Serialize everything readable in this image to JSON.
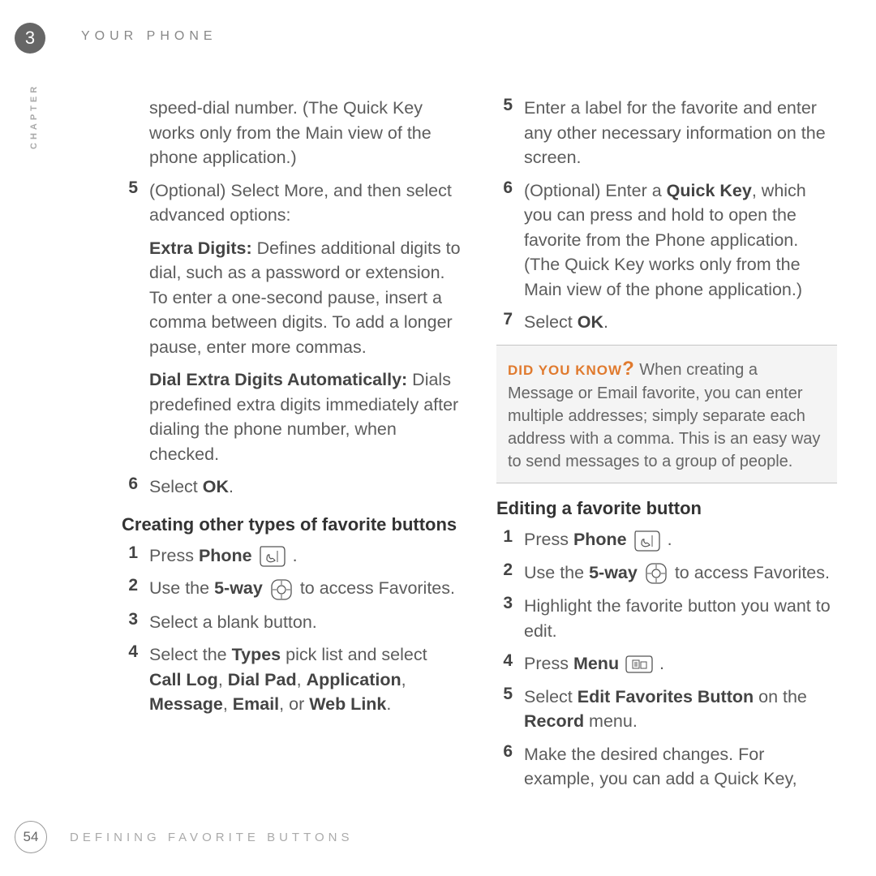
{
  "header": {
    "chapter_number": "3",
    "section_title": "YOUR PHONE",
    "chapter_label": "CHAPTER"
  },
  "left_col": {
    "intro": "speed-dial number. (The Quick Key works only from the Main view of the phone application.)",
    "step5_num": "5",
    "step5_text": "(Optional) Select More, and then select advanced options:",
    "extra_label": "Extra Digits:",
    "extra_text": " Defines additional digits to dial, such as a password or extension. To enter a one-second pause, insert a comma between digits. To add a longer pause, enter more commas.",
    "dial_label": "Dial Extra Digits Automatically:",
    "dial_text": " Dials predefined extra digits immediately after dialing the phone number, when checked.",
    "step6_num": "6",
    "step6_prefix": "Select ",
    "step6_bold": "OK",
    "step6_suffix": ".",
    "subhead": "Creating other types of favorite buttons",
    "c1_num": "1",
    "c1_prefix": "Press ",
    "c1_bold": "Phone",
    "c1_suffix": " .",
    "c2_num": "2",
    "c2_prefix": "Use the ",
    "c2_bold": "5-way",
    "c2_suffix": " to access Favorites.",
    "c3_num": "3",
    "c3_text": "Select a blank button.",
    "c4_num": "4",
    "c4_a": "Select the ",
    "c4_types": "Types",
    "c4_b": " pick list and select ",
    "c4_calllog": "Call Log",
    "c4_c": ", ",
    "c4_dialpad": "Dial Pad",
    "c4_d": ", ",
    "c4_app": "Application",
    "c4_e": ", ",
    "c4_msg": "Message",
    "c4_f": ", ",
    "c4_email": "Email",
    "c4_g": ", or ",
    "c4_web": "Web Link",
    "c4_h": "."
  },
  "right_col": {
    "r5_num": "5",
    "r5_text": "Enter a label for the favorite and enter any other necessary information on the screen.",
    "r6_num": "6",
    "r6_a": "(Optional)  Enter a ",
    "r6_bold": "Quick Key",
    "r6_b": ", which you can press and hold to open the favorite from the Phone application. (The Quick Key works only from the Main view of the phone application.)",
    "r7_num": "7",
    "r7_prefix": "Select ",
    "r7_bold": "OK",
    "r7_suffix": ".",
    "tip_label": "DID YOU KNOW",
    "tip_text": "  When creating a Message or Email favorite, you can enter multiple addresses; simply separate each address with a comma. This is an easy way to send messages to a group of people.",
    "subhead2": "Editing a favorite button",
    "e1_num": "1",
    "e1_prefix": "Press ",
    "e1_bold": "Phone",
    "e1_suffix": " .",
    "e2_num": "2",
    "e2_prefix": "Use the ",
    "e2_bold": "5-way",
    "e2_suffix": " to access Favorites.",
    "e3_num": "3",
    "e3_text": "Highlight the favorite button you want to edit.",
    "e4_num": "4",
    "e4_prefix": "Press ",
    "e4_bold": "Menu",
    "e4_suffix": " .",
    "e5_num": "5",
    "e5_a": "Select ",
    "e5_bold1": "Edit Favorites Button",
    "e5_b": " on the ",
    "e5_bold2": "Record",
    "e5_c": " menu.",
    "e6_num": "6",
    "e6_text": "Make the desired changes. For example, you can add a Quick Key,"
  },
  "footer": {
    "page_number": "54",
    "footer_title": "DEFINING FAVORITE BUTTONS"
  }
}
